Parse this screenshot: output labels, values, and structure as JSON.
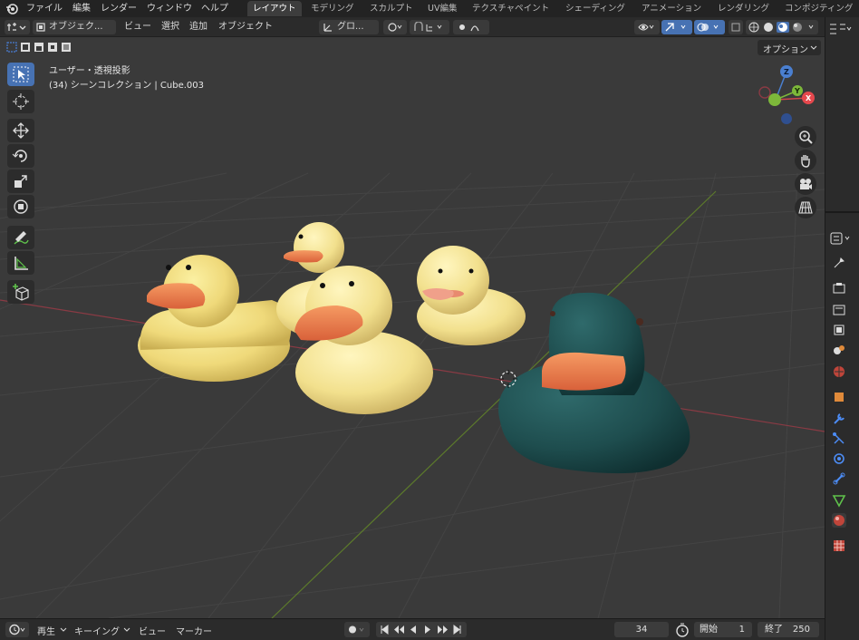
{
  "menu": {
    "items": [
      "ファイル",
      "編集",
      "レンダー",
      "ウィンドウ",
      "ヘルプ"
    ]
  },
  "workspaces": {
    "tabs": [
      "レイアウト",
      "モデリング",
      "スカルプト",
      "UV編集",
      "テクスチャペイント",
      "シェーディング",
      "アニメーション",
      "レンダリング",
      "コンポジティング"
    ],
    "active": "レイアウト"
  },
  "header": {
    "mode": "オブジェク...",
    "menus": [
      "ビュー",
      "選択",
      "追加",
      "オブジェクト"
    ],
    "transform_orientation": "グロ...",
    "options_label": "オプション"
  },
  "viewport": {
    "view_name": "ユーザー・透視投影",
    "collection_info": "(34) シーンコレクション | Cube.003",
    "gizmo": {
      "x": "X",
      "y": "Y",
      "z": "Z"
    }
  },
  "timeline": {
    "playback": "再生",
    "keying": "キーイング",
    "view": "ビュー",
    "marker": "マーカー",
    "current_frame": "34",
    "start_label": "開始",
    "start_value": "1",
    "end_label": "終了",
    "end_value": "250"
  },
  "colors": {
    "accent": "#4772b3",
    "x_axis": "#e5484d",
    "y_axis": "#8bc34a",
    "z_axis": "#3b82f6",
    "duck_yellow": "#f2de7e",
    "duck_beak": "#e8784a",
    "teal_duck": "#1f4e4f"
  }
}
